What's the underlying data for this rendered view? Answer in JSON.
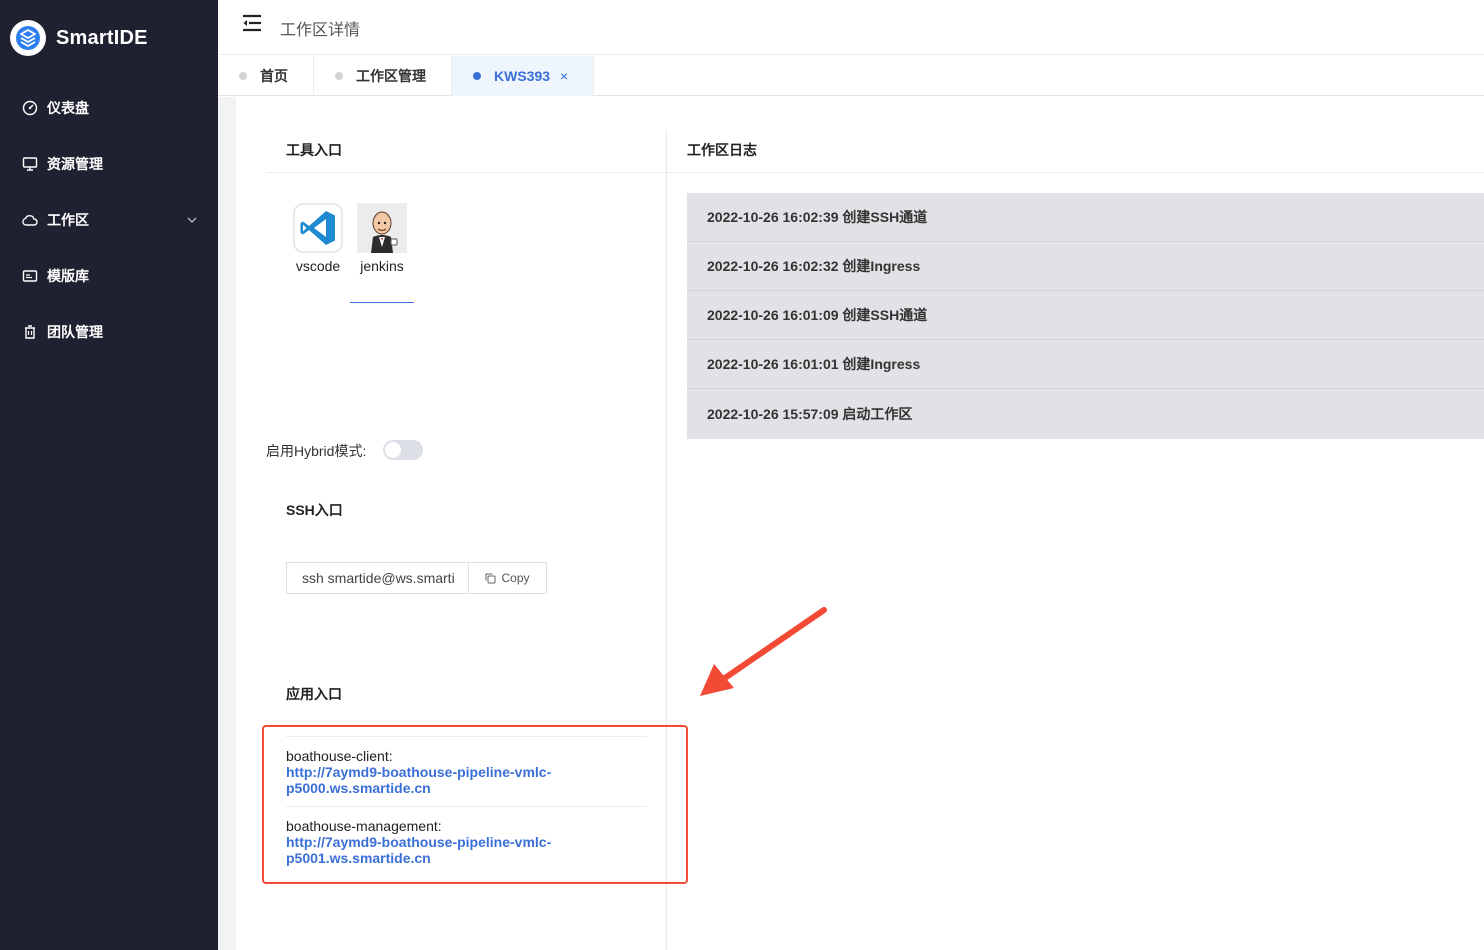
{
  "brand": {
    "name": "SmartIDE"
  },
  "sidebar": {
    "items": [
      {
        "label": "仪表盘",
        "icon": "dashboard-icon"
      },
      {
        "label": "资源管理",
        "icon": "monitor-icon"
      },
      {
        "label": "工作区",
        "icon": "cloud-icon",
        "expandable": true
      },
      {
        "label": "模版库",
        "icon": "template-icon"
      },
      {
        "label": "团队管理",
        "icon": "team-icon"
      }
    ]
  },
  "header": {
    "title": "工作区详情"
  },
  "tabs": [
    {
      "label": "首页",
      "active": false
    },
    {
      "label": "工作区管理",
      "active": false
    },
    {
      "label": "KWS393",
      "active": true,
      "closable": true,
      "close": "×"
    }
  ],
  "tools": {
    "title": "工具入口",
    "items": [
      {
        "label": "vscode",
        "icon": "vscode-icon"
      },
      {
        "label": "jenkins",
        "icon": "jenkins-icon"
      }
    ]
  },
  "hybrid": {
    "label": "启用Hybrid模式:",
    "enabled": false
  },
  "ssh": {
    "title": "SSH入口",
    "value": "ssh smartide@ws.smarti",
    "copy_label": "Copy"
  },
  "apps": {
    "title": "应用入口",
    "items": [
      {
        "name": "boathouse-client:",
        "url": "http://7aymd9-boathouse-pipeline-vmlc-p5000.ws.smartide.cn"
      },
      {
        "name": "boathouse-management:",
        "url": "http://7aymd9-boathouse-pipeline-vmlc-p5001.ws.smartide.cn"
      }
    ]
  },
  "logs": {
    "title": "工作区日志",
    "entries": [
      "2022-10-26 16:02:39 创建SSH通道",
      "2022-10-26 16:02:32 创建Ingress",
      "2022-10-26 16:01:09 创建SSH通道",
      "2022-10-26 16:01:01 创建Ingress",
      "2022-10-26 15:57:09 启动工作区"
    ]
  },
  "colors": {
    "sidebar_bg": "#1f2130",
    "accent": "#3a6fd8",
    "highlight": "#f24a35",
    "log_bg": "#e1e2e6"
  }
}
